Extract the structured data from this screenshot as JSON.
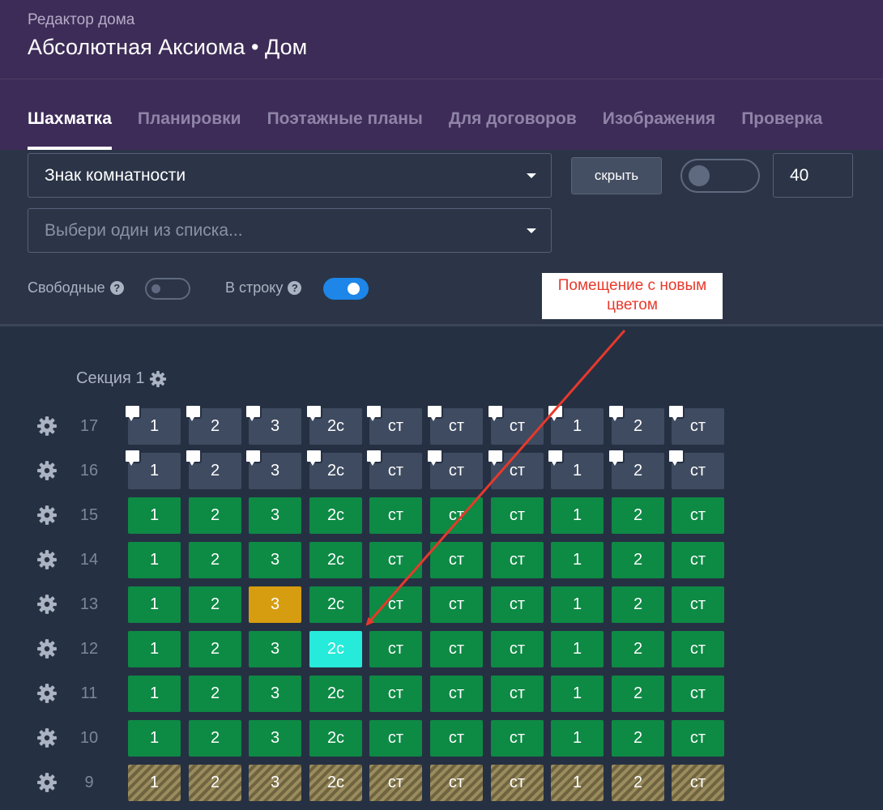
{
  "header": {
    "subtitle": "Редактор дома",
    "title": "Абсолютная Аксиома • Дом"
  },
  "tabs": [
    {
      "label": "Шахматка",
      "active": true
    },
    {
      "label": "Планировки",
      "active": false
    },
    {
      "label": "Поэтажные планы",
      "active": false
    },
    {
      "label": "Для договоров",
      "active": false
    },
    {
      "label": "Изображения",
      "active": false
    },
    {
      "label": "Проверка",
      "active": false
    }
  ],
  "controls": {
    "room_select_value": "Знак комнатности",
    "choose_placeholder": "Выбери один из списка...",
    "hide_button": "скрыть",
    "main_toggle_on": false,
    "number_value": "40",
    "free_label": "Свободные",
    "free_toggle_on": false,
    "inline_label": "В строку",
    "inline_toggle_on": true
  },
  "annotation": {
    "text_line1": "Помещение с новым",
    "text_line2": "цветом"
  },
  "section": {
    "title": "Секция 1",
    "columns": [
      "1",
      "2",
      "3",
      "2с",
      "ст",
      "ст",
      "ст",
      "1",
      "2",
      "ст"
    ],
    "floors": [
      {
        "floor": "17",
        "comment": true,
        "cells": [
          "gray",
          "gray",
          "gray",
          "gray",
          "gray",
          "gray",
          "gray",
          "gray",
          "gray",
          "gray"
        ]
      },
      {
        "floor": "16",
        "comment": true,
        "cells": [
          "gray",
          "gray",
          "gray",
          "gray",
          "gray",
          "gray",
          "gray",
          "gray",
          "gray",
          "gray"
        ]
      },
      {
        "floor": "15",
        "comment": false,
        "cells": [
          "green",
          "green",
          "green",
          "green",
          "green",
          "green",
          "green",
          "green",
          "green",
          "green"
        ]
      },
      {
        "floor": "14",
        "comment": false,
        "cells": [
          "green",
          "green",
          "green",
          "green",
          "green",
          "green",
          "green",
          "green",
          "green",
          "green"
        ]
      },
      {
        "floor": "13",
        "comment": false,
        "cells": [
          "green",
          "green",
          "orange",
          "green",
          "green",
          "green",
          "green",
          "green",
          "green",
          "green"
        ]
      },
      {
        "floor": "12",
        "comment": false,
        "cells": [
          "green",
          "green",
          "green",
          "cyan",
          "green",
          "green",
          "green",
          "green",
          "green",
          "green"
        ]
      },
      {
        "floor": "11",
        "comment": false,
        "cells": [
          "green",
          "green",
          "green",
          "green",
          "green",
          "green",
          "green",
          "green",
          "green",
          "green"
        ]
      },
      {
        "floor": "10",
        "comment": false,
        "cells": [
          "green",
          "green",
          "green",
          "green",
          "green",
          "green",
          "green",
          "green",
          "green",
          "green"
        ]
      },
      {
        "floor": "9",
        "comment": false,
        "cells": [
          "hatch",
          "hatch",
          "hatch",
          "hatch",
          "hatch",
          "hatch",
          "hatch",
          "hatch",
          "hatch",
          "hatch"
        ]
      }
    ]
  },
  "colors": {
    "header_bg": "#3d2c57",
    "panel_bg": "#2b3547",
    "page_bg": "#263043",
    "occupied_gray": "#3f4b60",
    "available_green": "#0d8a44",
    "reserved_orange": "#d69d10",
    "new_color_cyan": "#26eada",
    "toggle_blue": "#1d86e8",
    "annotation_red": "#e8392b"
  }
}
